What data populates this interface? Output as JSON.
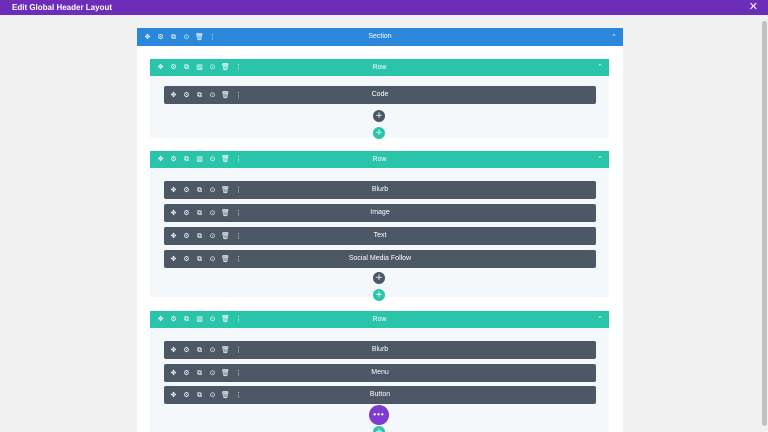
{
  "window": {
    "title": "Edit Global Header Layout",
    "close_glyph": "✕"
  },
  "section": {
    "label": "Section"
  },
  "rows": [
    {
      "label": "Row",
      "modules": [
        "Code"
      ]
    },
    {
      "label": "Row",
      "modules": [
        "Blurb",
        "Image",
        "Text",
        "Social Media Follow"
      ]
    },
    {
      "label": "Row",
      "modules": [
        "Blurb",
        "Menu",
        "Button"
      ]
    }
  ],
  "icons": {
    "move": "✥",
    "settings": "⚙",
    "duplicate": "⧉",
    "columns": "▥",
    "save": "⊙",
    "delete": "🗑",
    "more": "⋮",
    "collapse": "⌃",
    "add": "+",
    "fab": "•••"
  },
  "colors": {
    "title_bar": "#6c2eb9",
    "section": "#2b87da",
    "row": "#29c4a9",
    "module": "#4c5866",
    "fab": "#7e3bd0"
  }
}
